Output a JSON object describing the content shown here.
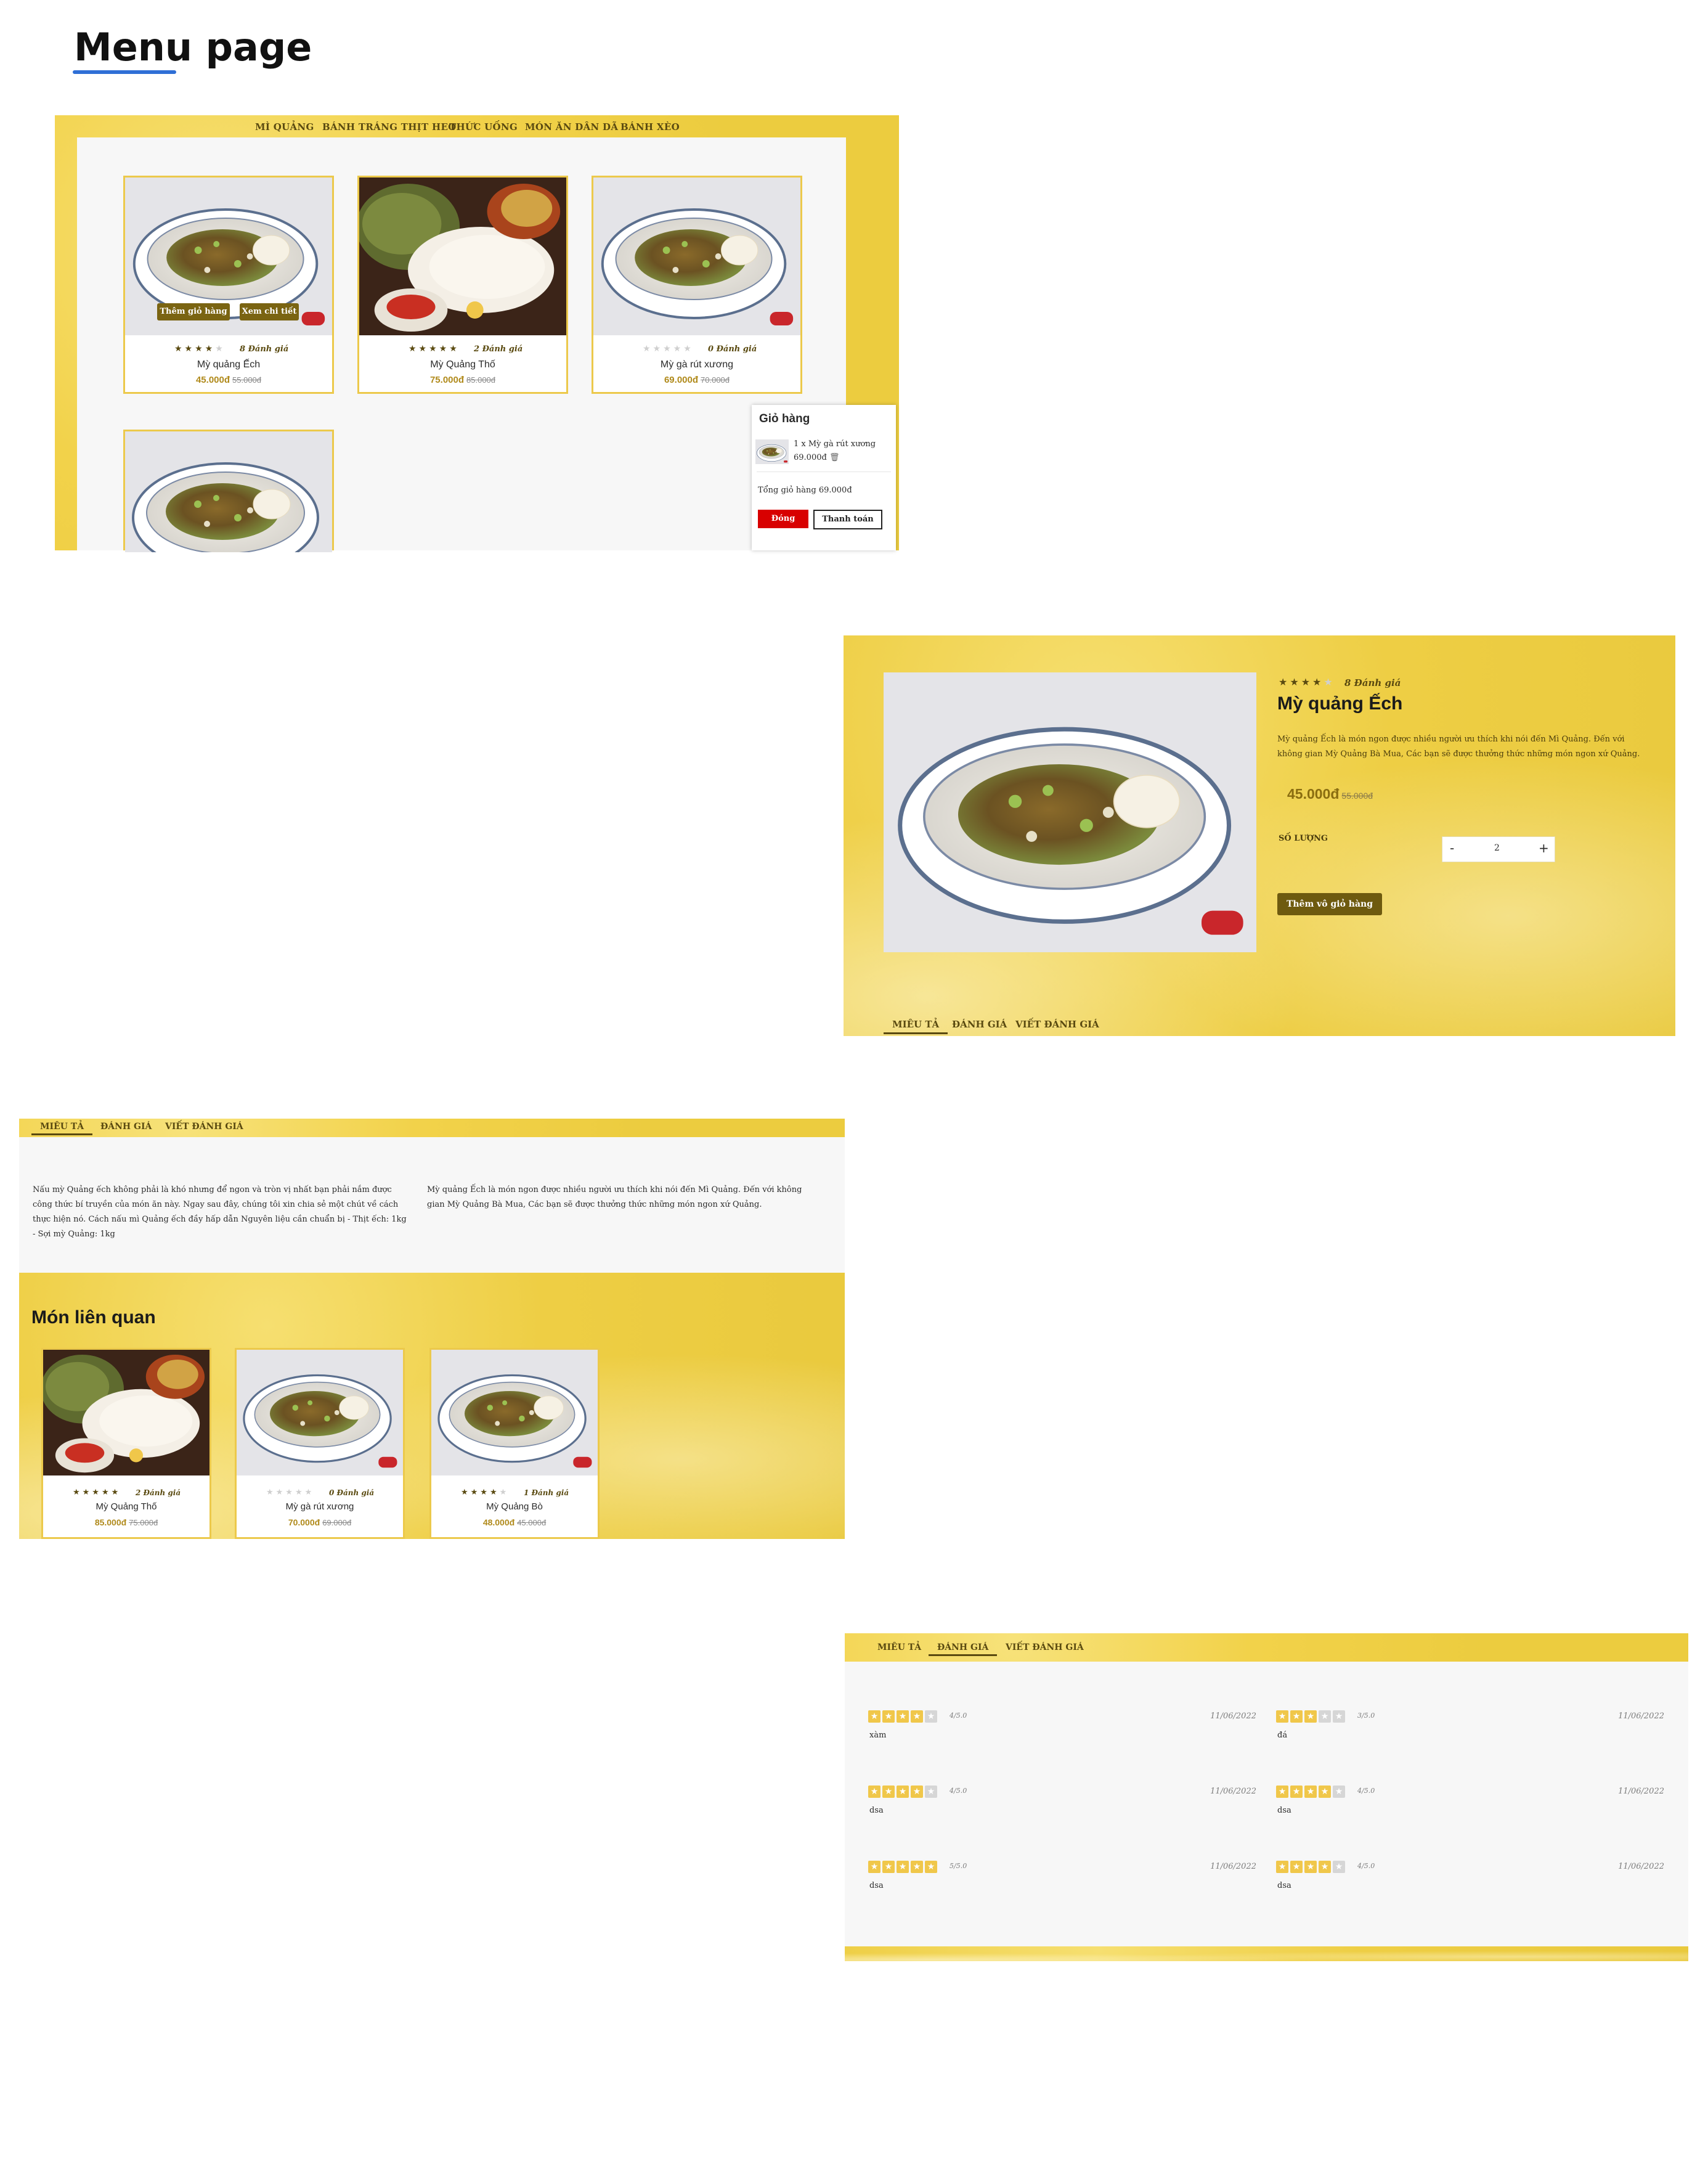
{
  "page_title": "Menu page",
  "menu": {
    "nav": [
      "MÌ QUẢNG",
      "BÁNH TRÁNG THỊT HEO",
      "THỨC UỐNG",
      "MÓN ĂN DÂN DÃ",
      "BÁNH XÈO"
    ],
    "cards": [
      {
        "rating": 4,
        "reviews": "8 Đánh giá",
        "name": "Mỳ quảng Ếch",
        "price": "45.000đ",
        "old_price": "55.000đ"
      },
      {
        "rating": 5,
        "reviews": "2 Đánh giá",
        "name": "Mỳ Quảng Thố",
        "price": "75.000đ",
        "old_price": "85.000đ"
      },
      {
        "rating": 0,
        "reviews": "0 Đánh giá",
        "name": "Mỳ gà rút xương",
        "price": "69.000đ",
        "old_price": "70.000đ"
      }
    ],
    "hover_add": "Thêm giỏ hàng",
    "hover_detail": "Xem chi tiết",
    "cart": {
      "title": "Giỏ hàng",
      "item_line": "1 x Mỳ gà rút xương",
      "item_price": "69.000đ",
      "total": "Tổng giỏ hàng 69.000đ",
      "close": "Đóng",
      "checkout": "Thanh toán"
    }
  },
  "detail": {
    "rating": 4,
    "reviews": "8 Đánh giá",
    "name": "Mỳ quảng Ếch",
    "description": "Mỳ quảng Ếch là món ngon được nhiều người ưu thích khi nói đến Mì Quảng. Đến với không gian Mỳ Quảng Bà Mua, Các bạn sẽ được thưởng thức những món ngon xứ Quảng.",
    "price": "45.000đ",
    "old_price": "55.000đ",
    "qty_label": "SỐ LƯỢNG",
    "qty_value": "2",
    "minus": "-",
    "plus": "+",
    "add_button": "Thêm vô giỏ hàng",
    "tabs": [
      "MIÊU TẢ",
      "ĐÁNH GIÁ",
      "VIẾT ĐÁNH GIÁ"
    ]
  },
  "desc_section": {
    "tabs": [
      "MIÊU TẢ",
      "ĐÁNH GIÁ",
      "VIẾT ĐÁNH GIÁ"
    ],
    "col1": "Nấu mỳ Quảng ếch không phải là khó nhưng để ngon và tròn vị nhất bạn phải nắm được công thức bí truyền của món ăn này. Ngay sau đây, chúng tôi xin chia sẻ một chút về cách thực hiện nó. Cách nấu mì Quảng ếch đầy hấp dẫn Nguyên liệu cần chuẩn bị - Thịt ếch: 1kg - Sợi mỳ Quảng: 1kg",
    "col2": "Mỳ quảng Ếch là món ngon được nhiều người ưu thích khi nói đến Mì Quảng. Đến với không gian Mỳ Quảng Bà Mua, Các bạn sẽ được thưởng thức những món ngon xứ Quảng.",
    "related_title": "Món liên quan",
    "related": [
      {
        "rating": 5,
        "reviews": "2 Đánh giá",
        "name": "Mỳ Quảng Thố",
        "price": "85.000đ",
        "old_price": "75.000đ"
      },
      {
        "rating": 0,
        "reviews": "0 Đánh giá",
        "name": "Mỳ gà rút xương",
        "price": "70.000đ",
        "old_price": "69.000đ"
      },
      {
        "rating": 4,
        "reviews": "1 Đánh giá",
        "name": "Mỳ Quảng Bò",
        "price": "48.000đ",
        "old_price": "45.000đ"
      }
    ]
  },
  "reviews_section": {
    "tabs": [
      "MIÊU TẢ",
      "ĐÁNH GIÁ",
      "VIẾT ĐÁNH GIÁ"
    ],
    "items": [
      {
        "stars": 4,
        "score": "4/5.0",
        "date": "11/06/2022",
        "text": "xàm"
      },
      {
        "stars": 3,
        "score": "3/5.0",
        "date": "11/06/2022",
        "text": "đá"
      },
      {
        "stars": 4,
        "score": "4/5.0",
        "date": "11/06/2022",
        "text": "dsa"
      },
      {
        "stars": 4,
        "score": "4/5.0",
        "date": "11/06/2022",
        "text": "dsa"
      },
      {
        "stars": 5,
        "score": "5/5.0",
        "date": "11/06/2022",
        "text": "dsa"
      },
      {
        "stars": 4,
        "score": "4/5.0",
        "date": "11/06/2022",
        "text": "dsa"
      }
    ]
  },
  "colors": {
    "accent_blue": "#2f6fd6",
    "olive": "#7a6412",
    "yellow": "#eccc3f",
    "close_red": "#d80000"
  },
  "icons": [
    "trash-icon",
    "star-icon",
    "minus-icon",
    "plus-icon"
  ]
}
